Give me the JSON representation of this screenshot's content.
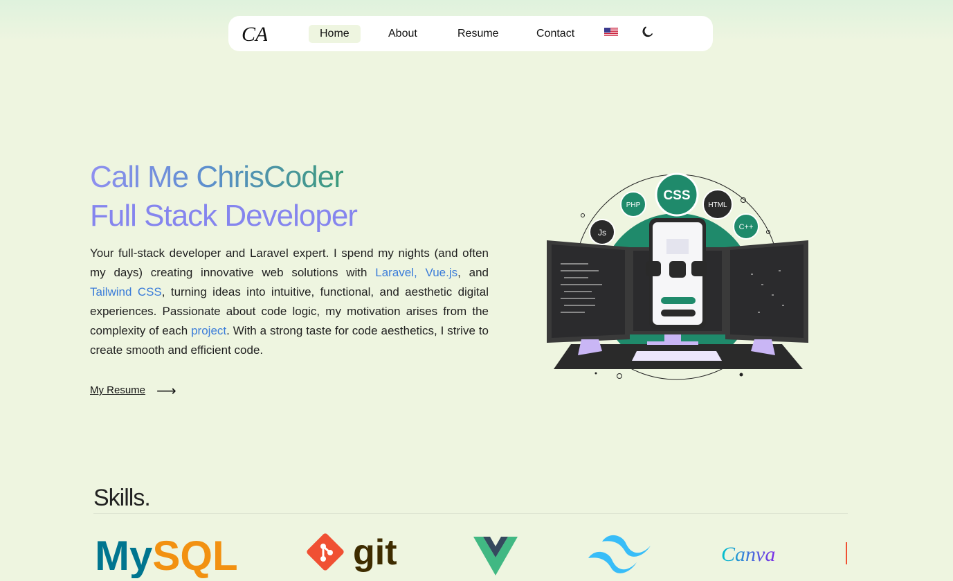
{
  "nav": {
    "logo_text": "CA",
    "items": [
      {
        "label": "Home",
        "active": true
      },
      {
        "label": "About",
        "active": false
      },
      {
        "label": "Resume",
        "active": false
      },
      {
        "label": "Contact",
        "active": false
      }
    ],
    "language_icon": "us-flag-icon",
    "theme_icon": "moon-icon"
  },
  "hero": {
    "title_line1": "Call Me ChrisCoder",
    "title_line2": "Full Stack Developer",
    "text_1": "Your full-stack developer and Laravel expert. I spend my nights (and often my days) creating innovative web solutions with ",
    "link_1": "Laravel, Vue.js",
    "text_2": ", and ",
    "link_2": "Tailwind CSS",
    "text_3": ", turning ideas into intuitive, functional, and aesthetic digital experiences. Passionate about code logic, my motivation arises from the complexity of each ",
    "link_3": "project",
    "text_4": ". With a strong taste for code aesthetics, I strive to create smooth and efficient code.",
    "resume_link": "My Resume",
    "resume_arrow": "⟶"
  },
  "illustration": {
    "badges": [
      "CSS",
      "PHP",
      "HTML",
      "Js",
      "C++"
    ]
  },
  "skills": {
    "title": "Skills.",
    "logos": [
      "MySQL",
      "git",
      "Vue",
      "Tailwind",
      "Canva"
    ]
  },
  "colors": {
    "background": "#eef5e0",
    "accent": "#8585ee",
    "link": "#3a7cd9",
    "teal": "#1f8a6b"
  }
}
